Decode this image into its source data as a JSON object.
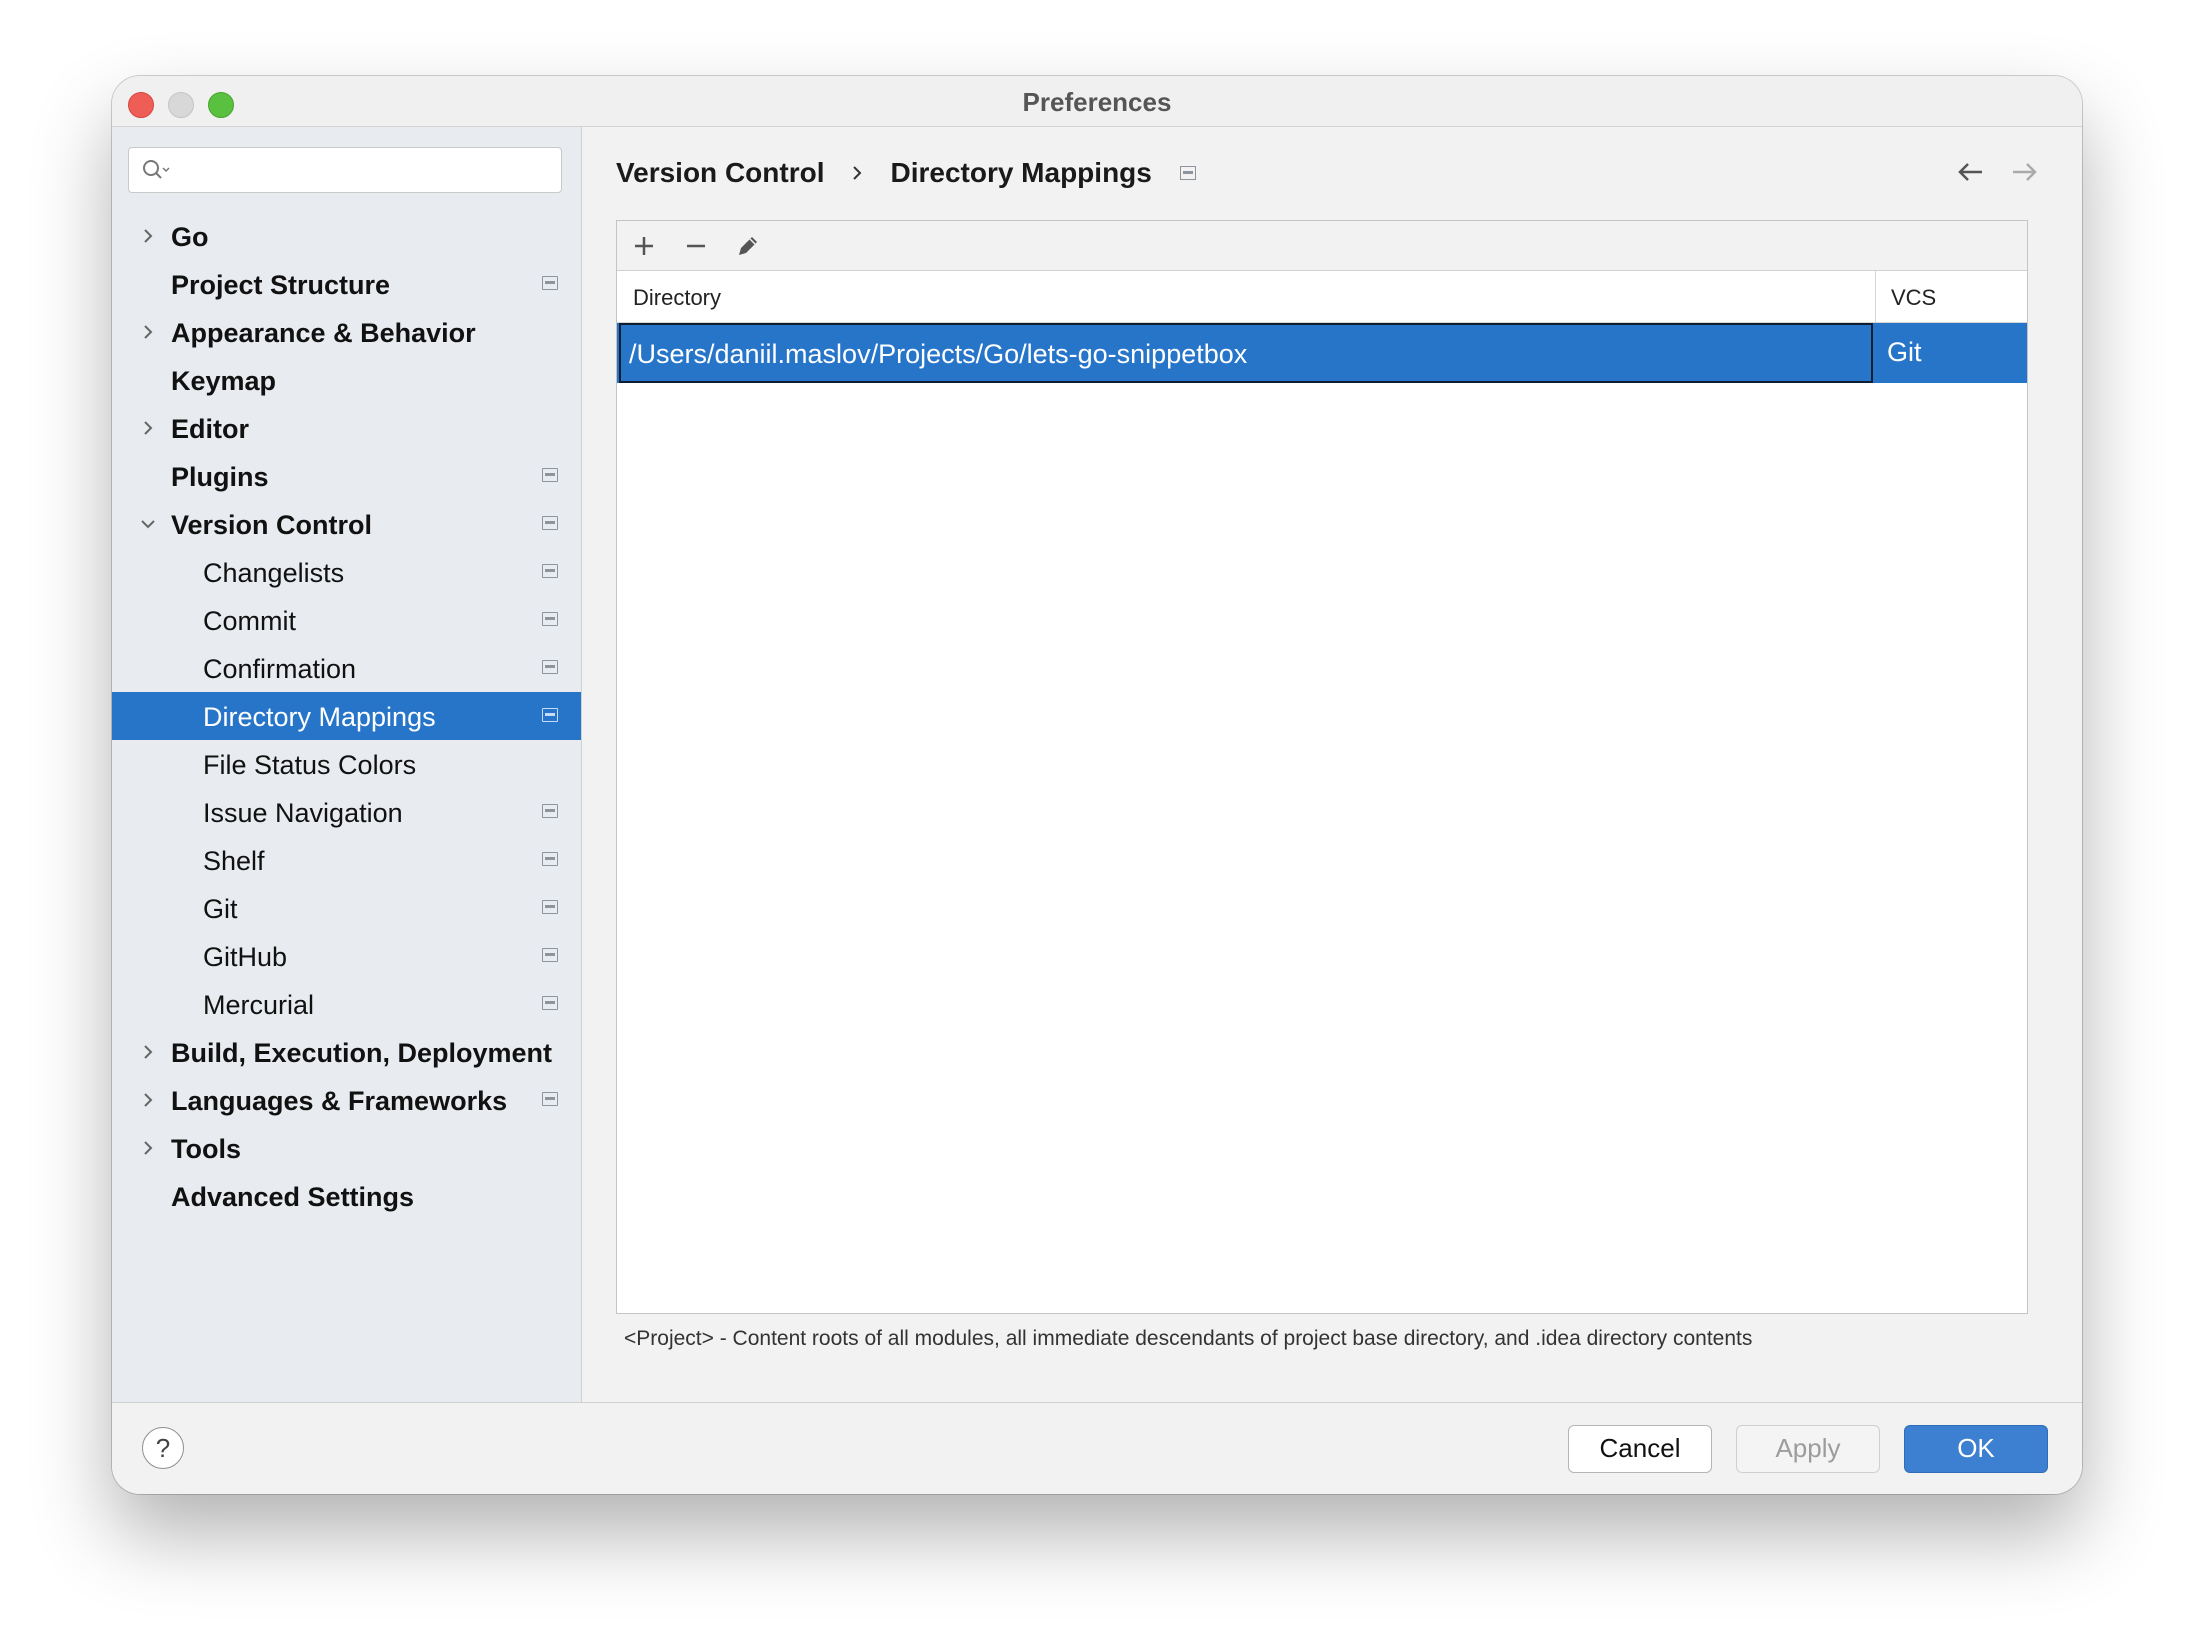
{
  "window": {
    "title": "Preferences"
  },
  "sidebar": {
    "search": {
      "value": "",
      "placeholder": ""
    },
    "items": [
      {
        "label": "Go",
        "level": "top",
        "expandable": true,
        "expanded": false,
        "project_icon": false
      },
      {
        "label": "Project Structure",
        "level": "top",
        "expandable": false,
        "project_icon": true
      },
      {
        "label": "Appearance & Behavior",
        "level": "top",
        "expandable": true,
        "expanded": false,
        "project_icon": false
      },
      {
        "label": "Keymap",
        "level": "top",
        "expandable": false,
        "project_icon": false
      },
      {
        "label": "Editor",
        "level": "top",
        "expandable": true,
        "expanded": false,
        "project_icon": false
      },
      {
        "label": "Plugins",
        "level": "top",
        "expandable": false,
        "project_icon": true
      },
      {
        "label": "Version Control",
        "level": "top",
        "expandable": true,
        "expanded": true,
        "project_icon": true
      },
      {
        "label": "Changelists",
        "level": "child",
        "project_icon": true
      },
      {
        "label": "Commit",
        "level": "child",
        "project_icon": true
      },
      {
        "label": "Confirmation",
        "level": "child",
        "project_icon": true
      },
      {
        "label": "Directory Mappings",
        "level": "child",
        "project_icon": true,
        "selected": true
      },
      {
        "label": "File Status Colors",
        "level": "child",
        "project_icon": false
      },
      {
        "label": "Issue Navigation",
        "level": "child",
        "project_icon": true
      },
      {
        "label": "Shelf",
        "level": "child",
        "project_icon": true
      },
      {
        "label": "Git",
        "level": "child",
        "project_icon": true
      },
      {
        "label": "GitHub",
        "level": "child",
        "project_icon": true
      },
      {
        "label": "Mercurial",
        "level": "child",
        "project_icon": true
      },
      {
        "label": "Build, Execution, Deployment",
        "level": "top",
        "expandable": true,
        "expanded": false,
        "project_icon": false
      },
      {
        "label": "Languages & Frameworks",
        "level": "top",
        "expandable": true,
        "expanded": false,
        "project_icon": true
      },
      {
        "label": "Tools",
        "level": "top",
        "expandable": true,
        "expanded": false,
        "project_icon": false
      },
      {
        "label": "Advanced Settings",
        "level": "top",
        "expandable": false,
        "project_icon": false
      }
    ]
  },
  "breadcrumb": {
    "parent": "Version Control",
    "current": "Directory Mappings"
  },
  "toolbar": {
    "icons": [
      "add-icon",
      "remove-icon",
      "edit-icon"
    ]
  },
  "table": {
    "columns": [
      "Directory",
      "VCS"
    ],
    "rows": [
      {
        "directory": "/Users/daniil.maslov/Projects/Go/lets-go-snippetbox",
        "vcs": "Git",
        "selected": true
      }
    ]
  },
  "hint": "<Project> - Content roots of all modules, all immediate descendants of project base directory, and .idea directory contents",
  "footer": {
    "help": "?",
    "cancel": "Cancel",
    "apply": "Apply",
    "ok": "OK"
  },
  "colors": {
    "selection": "#2675c9",
    "sidebar_bg": "#e8ebef",
    "ok_button": "#3d7fd0"
  }
}
